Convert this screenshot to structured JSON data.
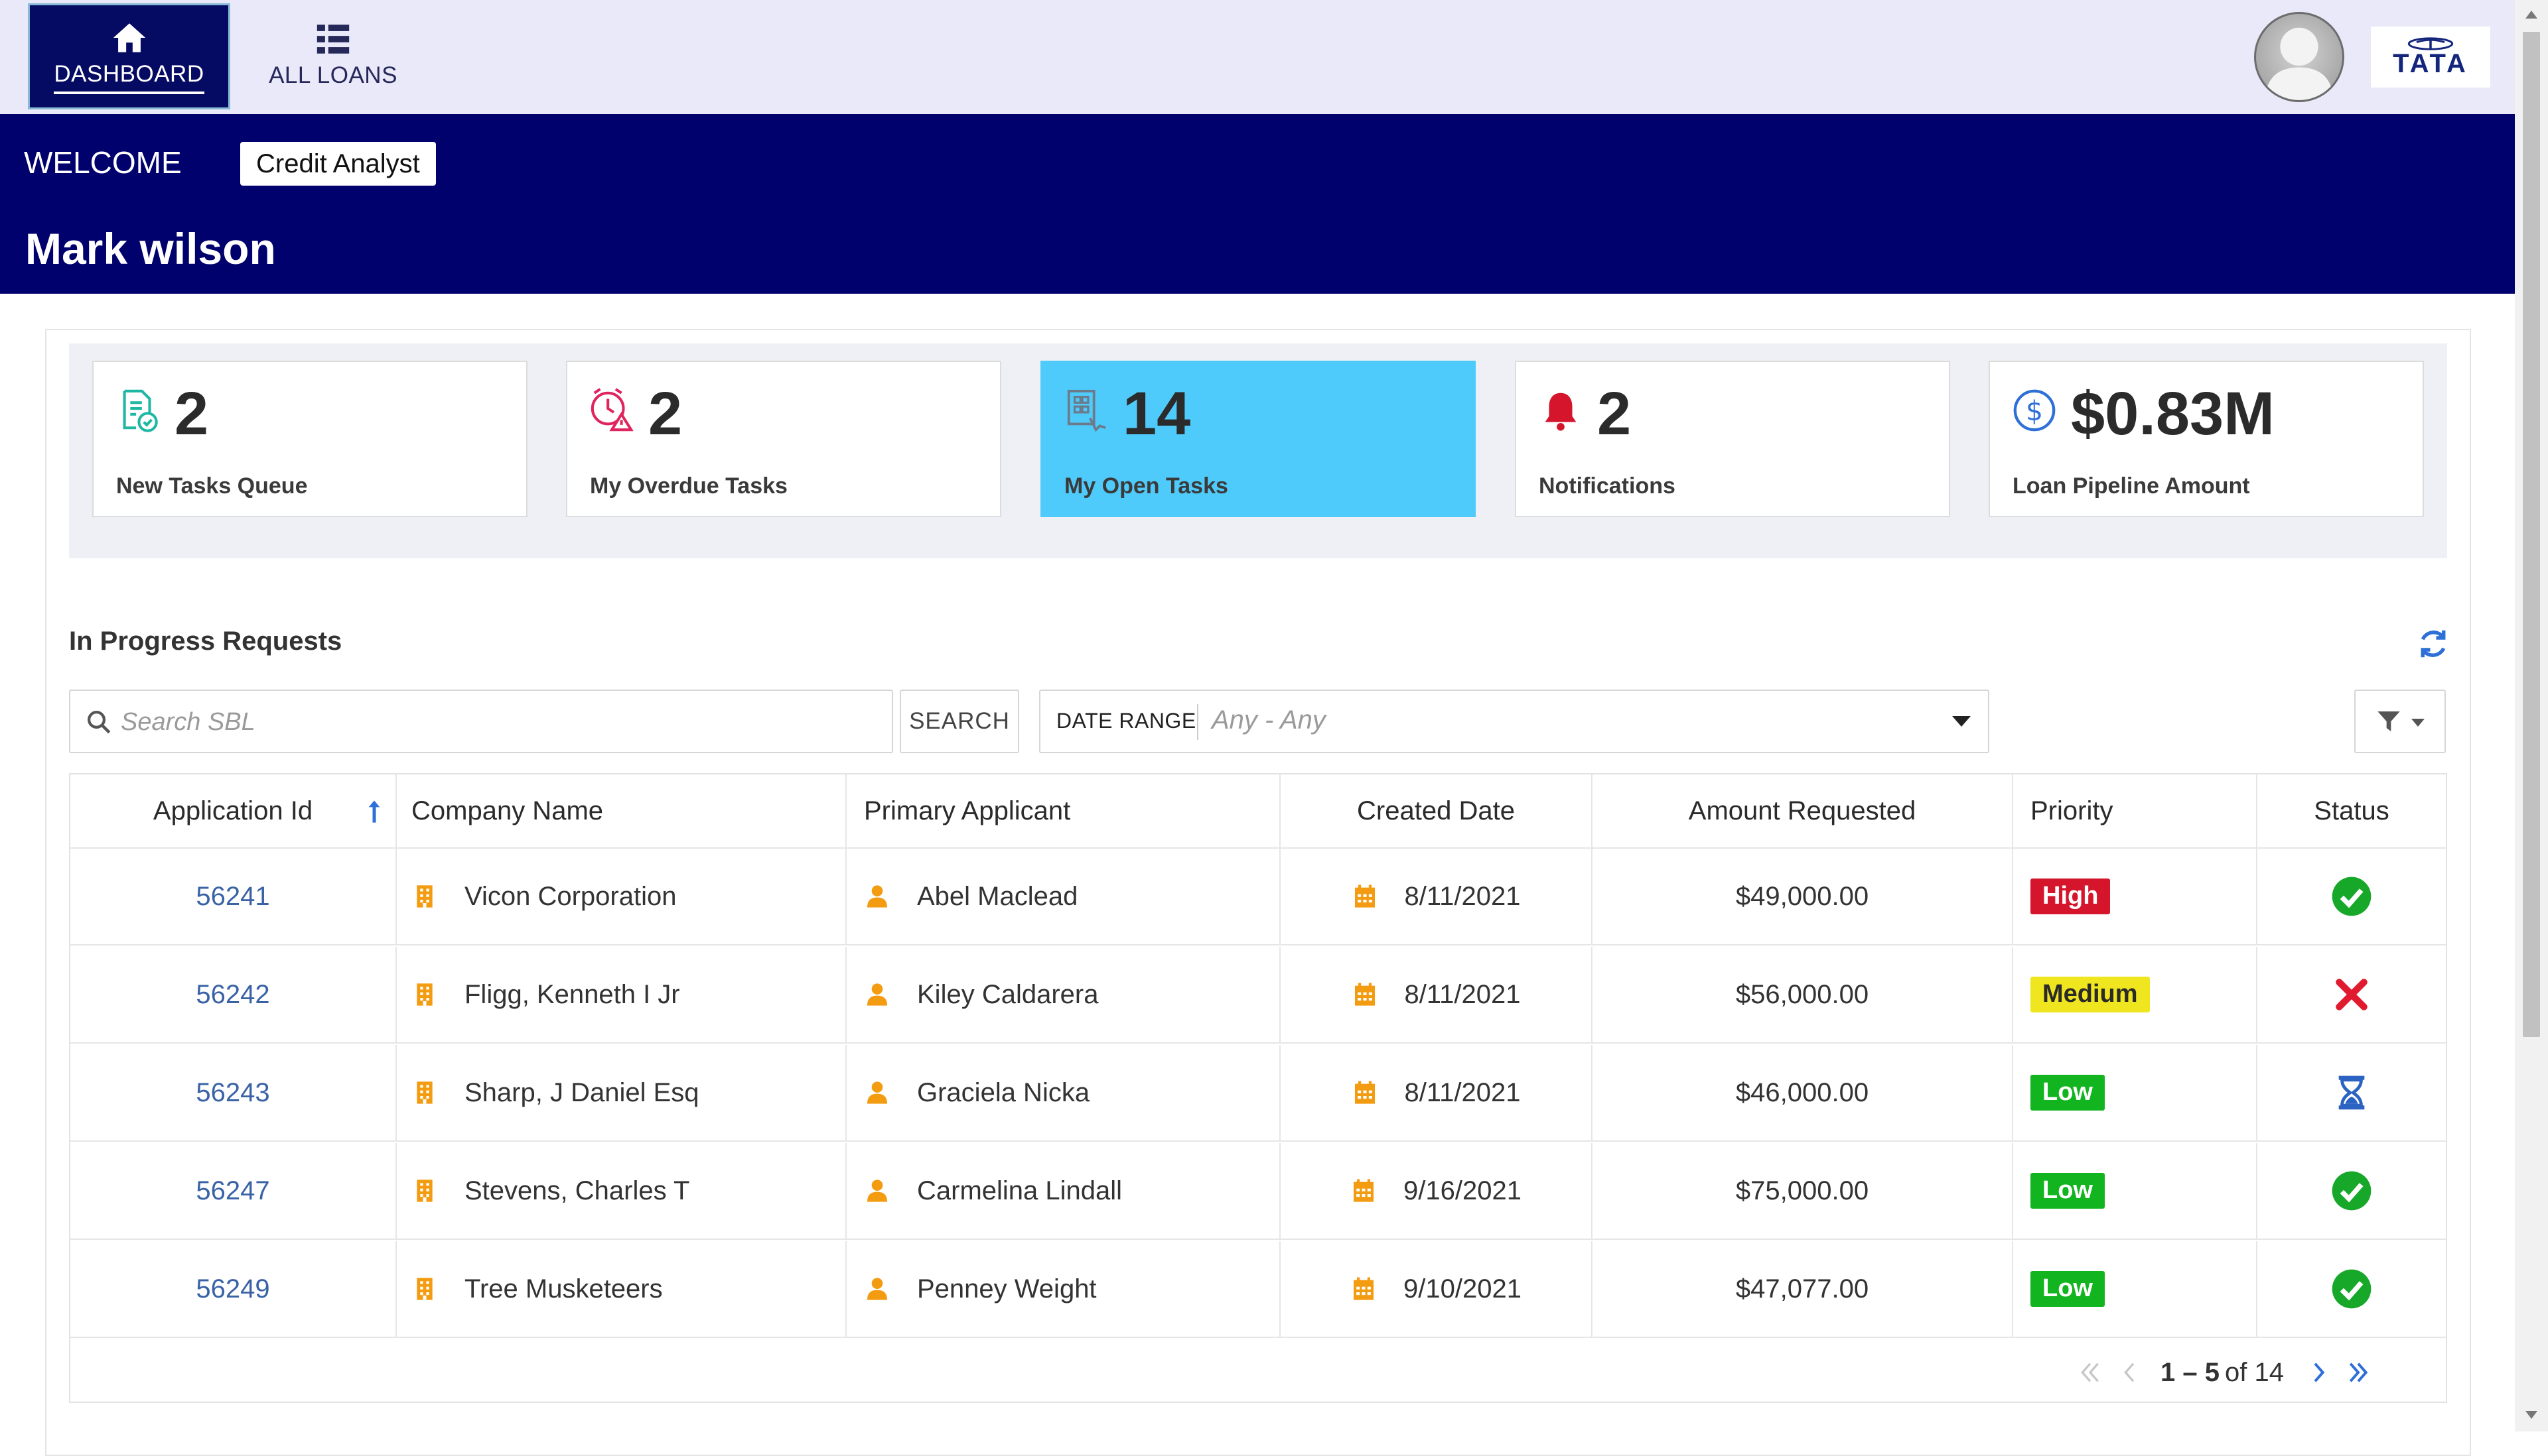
{
  "nav": {
    "tabs": [
      {
        "label": "DASHBOARD",
        "icon": "home-icon",
        "active": true
      },
      {
        "label": "ALL LOANS",
        "icon": "list-icon",
        "active": false
      }
    ],
    "logo_text": "TATA"
  },
  "banner": {
    "welcome": "WELCOME",
    "role": "Credit Analyst",
    "user_name": "Mark wilson"
  },
  "stats": [
    {
      "value": "2",
      "label": "New Tasks Queue",
      "icon": "task-queue-icon"
    },
    {
      "value": "2",
      "label": "My Overdue Tasks",
      "icon": "overdue-clock-icon"
    },
    {
      "value": "14",
      "label": "My Open Tasks",
      "icon": "open-tasks-icon",
      "highlight": true
    },
    {
      "value": "2",
      "label": "Notifications",
      "icon": "bell-icon"
    },
    {
      "value": "$0.83M",
      "label": "Loan Pipeline Amount",
      "icon": "dollar-coin-icon"
    }
  ],
  "section": {
    "title": "In Progress Requests",
    "search_placeholder": "Search SBL",
    "search_button": "SEARCH",
    "date_range_label": "DATE RANGE",
    "date_range_value": "Any - Any"
  },
  "table": {
    "columns": [
      "Application Id",
      "Company Name",
      "Primary Applicant",
      "Created Date",
      "Amount Requested",
      "Priority",
      "Status"
    ],
    "rows": [
      {
        "id": "56241",
        "company": "Vicon Corporation",
        "applicant": "Abel Maclead",
        "date": "8/11/2021",
        "amount": "$49,000.00",
        "priority": "High",
        "status": "approved"
      },
      {
        "id": "56242",
        "company": "Fligg, Kenneth I Jr",
        "applicant": "Kiley Caldarera",
        "date": "8/11/2021",
        "amount": "$56,000.00",
        "priority": "Medium",
        "status": "rejected"
      },
      {
        "id": "56243",
        "company": "Sharp, J Daniel Esq",
        "applicant": "Graciela Nicka",
        "date": "8/11/2021",
        "amount": "$46,000.00",
        "priority": "Low",
        "status": "pending"
      },
      {
        "id": "56247",
        "company": "Stevens, Charles T",
        "applicant": "Carmelina Lindall",
        "date": "9/16/2021",
        "amount": "$75,000.00",
        "priority": "Low",
        "status": "approved"
      },
      {
        "id": "56249",
        "company": "Tree Musketeers",
        "applicant": "Penney Weight",
        "date": "9/10/2021",
        "amount": "$47,077.00",
        "priority": "Low",
        "status": "approved"
      }
    ]
  },
  "pager": {
    "range": "1 – 5",
    "of_total": "of 14"
  },
  "colors": {
    "banner": "#01016d",
    "nav_active": "#050a63",
    "highlight_card": "#4fcbfb",
    "priority_high": "#d4152b",
    "priority_medium": "#f0e61f",
    "priority_low": "#12b51f",
    "icon_orange": "#f39c12"
  }
}
